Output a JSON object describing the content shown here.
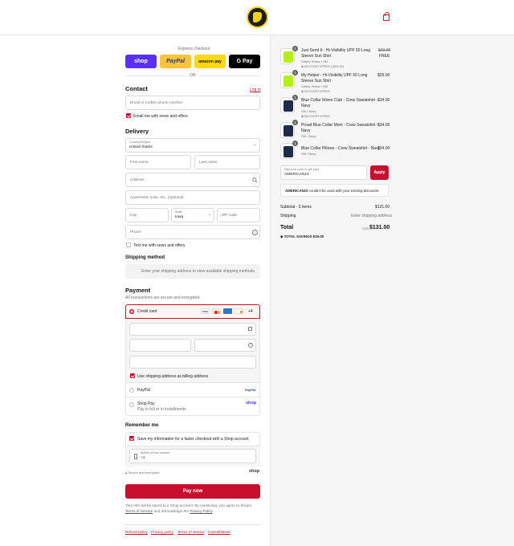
{
  "header": {
    "logo": "logo",
    "cart_icon": "shopping-bag-icon"
  },
  "express": {
    "title": "Express checkout",
    "or": "OR",
    "shop": "shop",
    "paypal": "PayPal",
    "amazon": "amazon pay",
    "gpay": "G Pay"
  },
  "contact": {
    "title": "Contact",
    "login": "Log in",
    "email_placeholder": "Email or mobile phone number",
    "news_label": "Email me with news and offers"
  },
  "delivery": {
    "title": "Delivery",
    "country_label": "Country/Region",
    "country_value": "United States",
    "first_name": "First name",
    "last_name": "Last name",
    "address": "Address",
    "apartment": "Apartment, suite, etc. (optional)",
    "city": "City",
    "state_label": "State",
    "state_value": "Iowa",
    "zip": "ZIP code",
    "phone": "Phone",
    "text_label": "Text me with news and offers"
  },
  "shipping_method": {
    "title": "Shipping method",
    "note": "Enter your shipping address to view available shipping methods."
  },
  "payment": {
    "title": "Payment",
    "subtitle": "All transactions are secure and encrypted.",
    "credit_card": "Credit card",
    "more_cards": "+4",
    "visa": "VISA",
    "billing_label": "Use shipping address as billing address",
    "paypal": "PayPal",
    "paypal_logo": "PayPal",
    "shop_pay": "Shop Pay",
    "shop_pay_sub": "Pay in full or in installments",
    "shop_logo": "shop"
  },
  "remember": {
    "title": "Remember me",
    "save_label": "Save my information for a faster checkout with a Shop account",
    "mobile_label": "Mobile phone number",
    "mobile_value": "+1",
    "secure": "Secure and encrypted",
    "shop_logo": "shop"
  },
  "pay_button": "Pay now",
  "consent": {
    "text1": "Your info will be saved to a Shop account. By continuing, you agree to Shop's",
    "tos": "Terms of Service",
    "text2": "and acknowledge the",
    "privacy": "Privacy Policy",
    "dot": "."
  },
  "footer_links": [
    "Refund policy",
    "Privacy policy",
    "Terms of service",
    "Cancellations"
  ],
  "cart": {
    "items": [
      {
        "qty": "1",
        "name_line1": "Just Send It - Hi-Visibility UPF 50 Long",
        "name_line2": "Sleeve Sun Shirt",
        "variant": "Safety Yellow / SM",
        "discount": "BUY2GET1FREE (-$29.00)",
        "orig_price": "$29.00",
        "price": "FREE",
        "color": "#b5ef18"
      },
      {
        "qty": "1",
        "name_line1": "My Helper - Hi-Visibility UPF 50 Long",
        "name_line2": "Sleeve Sun Shirt",
        "variant": "Safety Yellow / SM",
        "discount": "BUY2GET1FREE",
        "price": "$29.00",
        "color": "#b5ef18"
      },
      {
        "qty": "1",
        "name_line1": "Blue Collar Wives Club - Crew Sweatshirt -",
        "name_line2": "Navy",
        "variant": "SM / Navy",
        "discount": "BUY2GET1FREE",
        "price": "$34.00",
        "color": "#1f2b4a"
      },
      {
        "qty": "1",
        "name_line1": "Proud Blue Collar Mom - Crew Sweatshirt -",
        "name_line2": "Navy",
        "variant": "SM / Navy",
        "price": "$34.00",
        "color": "#1f2b4a"
      },
      {
        "qty": "1",
        "name_line1": "Blue Collar Pillows - Crew Sweatshirt - Navy",
        "variant": "SM / Navy",
        "price": "$34.00",
        "color": "#1f2b4a"
      }
    ],
    "discount_label": "Discount code or gift card",
    "discount_value": "AMERICAN10",
    "apply": "Apply",
    "error_code": "AMERICAN10",
    "error_text": "couldn't be used with your existing discounts.",
    "subtotal_label": "Subtotal · 5 items",
    "subtotal_value": "$131.00",
    "shipping_label": "Shipping",
    "shipping_value": "Enter shipping address",
    "total_label": "Total",
    "currency": "USD",
    "total_value": "$131.00",
    "savings_label": "TOTAL SAVINGS",
    "savings_value": "$29.00"
  },
  "colors": {
    "brand_red": "#c8102e",
    "shop_purple": "#5a31f4"
  }
}
